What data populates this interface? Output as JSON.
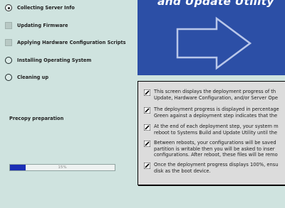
{
  "steps": [
    {
      "label": "Collecting Server Info",
      "state": "current",
      "icon": "radio-selected-icon"
    },
    {
      "label": "Updating Firmware",
      "state": "done",
      "icon": "checkbox-icon"
    },
    {
      "label": "Applying Hardware Configuration Scripts",
      "state": "done",
      "icon": "checkbox-icon"
    },
    {
      "label": "Installing Operating System",
      "state": "pending",
      "icon": "radio-empty-icon"
    },
    {
      "label": "Cleaning up",
      "state": "pending",
      "icon": "radio-empty-icon"
    }
  ],
  "task": {
    "label": "Precopy preparation"
  },
  "progress": {
    "value": 0.15,
    "label": "15%"
  },
  "banner": {
    "title": "and Update Utility",
    "icon": "arrow-icon"
  },
  "info": {
    "paragraphs": [
      "This screen displays the deployment progress of th\nUpdate, Hardware Configuration, and/or Server Ope",
      "The deployment progress is displayed in percentage\nGreen against a deployment step indicates that the",
      "At the end of each deployment step, your system m\nreboot to Systems Build and Update Utility until the",
      "Between reboots, your configurations will be saved\npartition is writable then you will be asked to inser\nconfigurations. After reboot, these files will be remo",
      "Once the deployment progress displays 100%, ensu\ndisk as the boot device."
    ],
    "bullet_icon": "note-icon"
  },
  "colors": {
    "background": "#cfe3df",
    "banner": "#2c4fa6",
    "progress_fill": "#1b2fb5",
    "panel": "#dcdcdc"
  }
}
